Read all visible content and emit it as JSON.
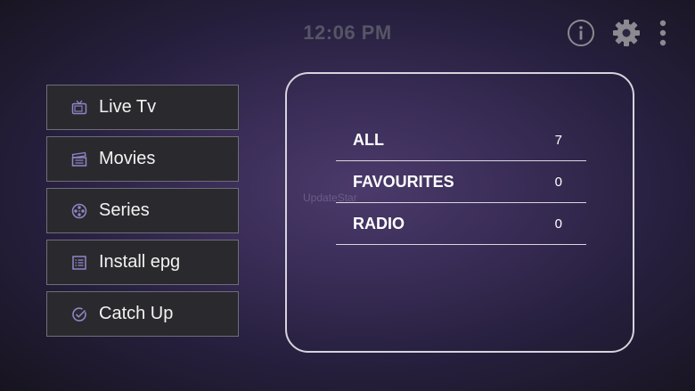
{
  "header": {
    "time": "12:06 PM",
    "icons": [
      "info-icon",
      "gear-icon",
      "more-vertical-icon"
    ]
  },
  "menu": {
    "items": [
      {
        "label": "Live Tv",
        "icon": "tv-icon"
      },
      {
        "label": "Movies",
        "icon": "clapperboard-icon"
      },
      {
        "label": "Series",
        "icon": "film-reel-icon"
      },
      {
        "label": "Install epg",
        "icon": "list-icon"
      },
      {
        "label": "Catch Up",
        "icon": "check-circle-icon"
      }
    ]
  },
  "panel": {
    "watermark": "UpdateStar",
    "categories": [
      {
        "name": "ALL",
        "count": "7"
      },
      {
        "name": "FAVOURITES",
        "count": "0"
      },
      {
        "name": "RADIO",
        "count": "0"
      }
    ]
  },
  "colors": {
    "icon_accent": "#8f86c9",
    "top_icon": "#8a8a90",
    "clock": "#565566",
    "panel_border": "#d6d3dd"
  }
}
